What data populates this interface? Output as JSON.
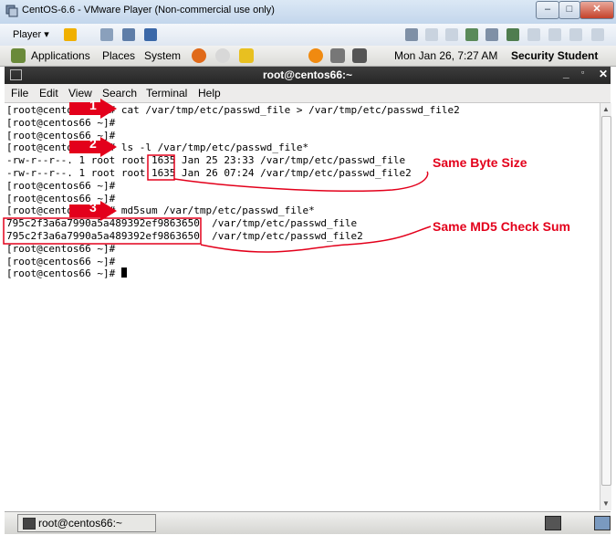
{
  "window": {
    "title": "CentOS-6.6 - VMware Player (Non-commercial use only)",
    "controls": [
      "–",
      "□",
      "✕"
    ]
  },
  "vm_toolbar": {
    "player_label": "Player"
  },
  "gnome_panel": {
    "applications": "Applications",
    "places": "Places",
    "system": "System",
    "clock": "Mon Jan 26,  7:27 AM",
    "user": "Security Student"
  },
  "terminal": {
    "title": "root@centos66:~",
    "menu": [
      "File",
      "Edit",
      "View",
      "Search",
      "Terminal",
      "Help"
    ],
    "lines": [
      "[root@centos66 ~]# cat /var/tmp/etc/passwd_file > /var/tmp/etc/passwd_file2",
      "[root@centos66 ~]#",
      "[root@centos66 ~]#",
      "[root@centos66 ~]# ls -l /var/tmp/etc/passwd_file*",
      "-rw-r--r--. 1 root root 1635 Jan 25 23:33 /var/tmp/etc/passwd_file",
      "-rw-r--r--. 1 root root 1635 Jan 26 07:24 /var/tmp/etc/passwd_file2",
      "[root@centos66 ~]#",
      "[root@centos66 ~]#",
      "[root@centos66 ~]# md5sum /var/tmp/etc/passwd_file*",
      "795c2f3a6a7990a5a489392ef9863650  /var/tmp/etc/passwd_file",
      "795c2f3a6a7990a5a489392ef9863650  /var/tmp/etc/passwd_file2",
      "[root@centos66 ~]#",
      "[root@centos66 ~]#"
    ],
    "prompt": "[root@centos66 ~]# "
  },
  "annotations": {
    "step1": "1",
    "step2": "2",
    "step3": "3",
    "byte_size_label": "Same Byte Size",
    "md5_label": "Same MD5 Check Sum",
    "color": "#e3001b"
  },
  "taskbar": {
    "item": "root@centos66:~"
  }
}
